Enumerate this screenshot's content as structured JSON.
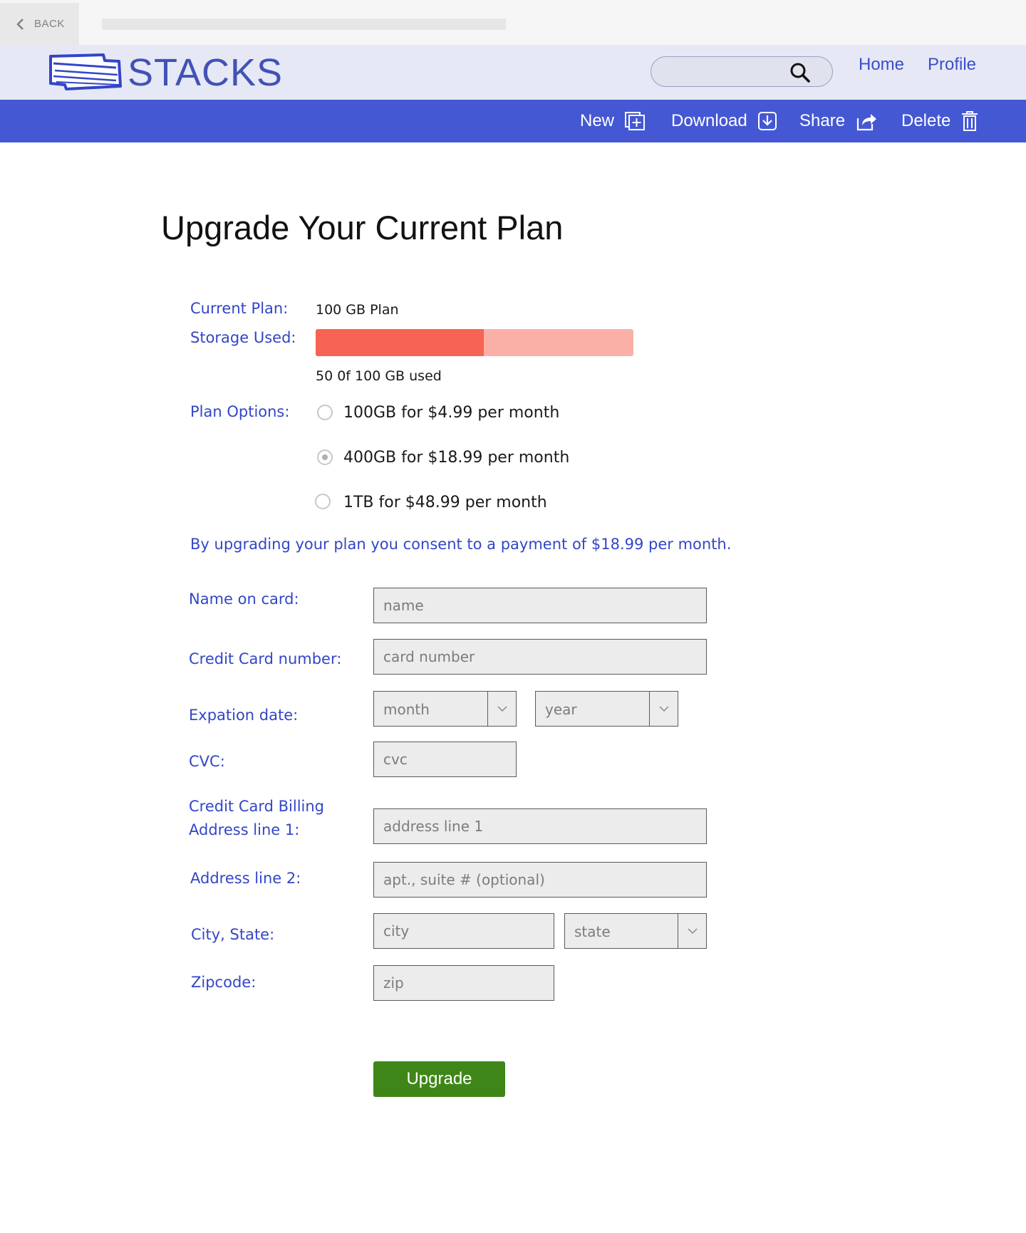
{
  "browser": {
    "back_label": "BACK"
  },
  "header": {
    "logo_text": "STACKS",
    "nav": {
      "home": "Home",
      "profile": "Profile"
    }
  },
  "toolbar": {
    "new_label": "New",
    "download_label": "Download",
    "share_label": "Share",
    "delete_label": "Delete"
  },
  "main": {
    "title": "Upgrade Your Current Plan",
    "current_plan_label": "Current  Plan:",
    "current_plan_value": "100 GB  Plan",
    "storage_label": "Storage Used:",
    "storage_used_fraction": 0.5,
    "storage_text": "50 0f 100 GB used",
    "plan_options_label": "Plan Options:",
    "plan_options": [
      {
        "label": "100GB for $4.99 per month",
        "selected": false
      },
      {
        "label": "400GB for $18.99 per month",
        "selected": true
      },
      {
        "label": "1TB for $48.99 per month",
        "selected": false
      }
    ],
    "consent_text": "By upgrading your plan you consent to a payment of $18.99 per month."
  },
  "form": {
    "name_label": "Name on card:",
    "name_placeholder": "name",
    "card_label": "Credit Card number:",
    "card_placeholder": "card number",
    "exp_label": "Expation date:",
    "month_value": "month",
    "year_value": "year",
    "cvc_label": "CVC:",
    "cvc_placeholder": "cvc",
    "addr1_label_line1": "Credit Card  Billing",
    "addr1_label_line2": "Address line 1:",
    "addr1_placeholder": "address line 1",
    "addr2_label": "Address line 2:",
    "addr2_placeholder": "apt., suite # (optional)",
    "city_label": "City, State:",
    "city_placeholder": "city",
    "state_value": "state",
    "zip_label": "Zipcode:",
    "zip_placeholder": "zip",
    "submit_label": "Upgrade"
  },
  "colors": {
    "brand": "#4152b5",
    "toolbar": "#4558d3",
    "progress_fill": "#f76354",
    "progress_track": "#fbb0a7",
    "submit": "#3f8618"
  }
}
